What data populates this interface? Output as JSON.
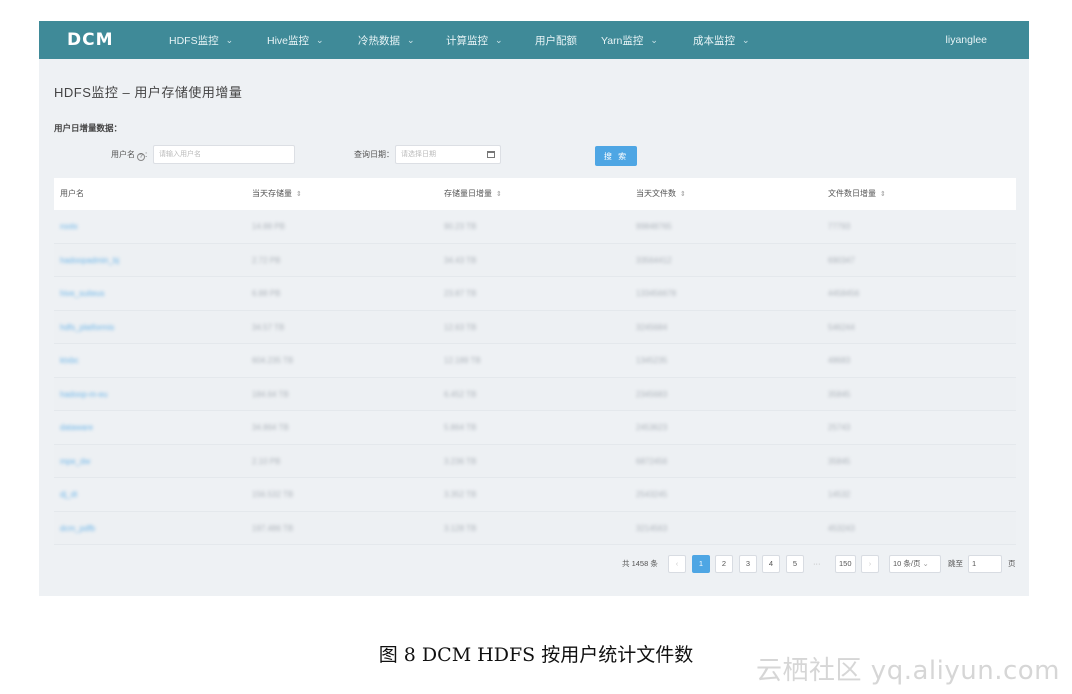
{
  "nav": {
    "logo": "DCM",
    "items": [
      {
        "label": "HDFS监控",
        "chevron": "⌄"
      },
      {
        "label": "Hive监控",
        "chevron": "⌄"
      },
      {
        "label": "冷热数据",
        "chevron": "⌄"
      },
      {
        "label": "计算监控",
        "chevron": "⌄"
      },
      {
        "label": "用户配额",
        "chevron": ""
      },
      {
        "label": "Yarn监控",
        "chevron": "⌄"
      },
      {
        "label": "成本监控",
        "chevron": "⌄"
      }
    ],
    "user": "liyanglee"
  },
  "page": {
    "title": "HDFS监控 – 用户存储使用增量",
    "section_label": "用户日增量数据："
  },
  "filters": {
    "username_label": "用户名",
    "username_placeholder": "请输入用户名",
    "date_label": "查询日期：",
    "date_placeholder": "请选择日期",
    "search_button": "搜 索"
  },
  "table": {
    "columns": [
      {
        "label": "用户名",
        "sortable": false
      },
      {
        "label": "当天存储量",
        "sortable": true
      },
      {
        "label": "存储量日增量",
        "sortable": true
      },
      {
        "label": "当天文件数",
        "sortable": true
      },
      {
        "label": "文件数日增量",
        "sortable": true
      }
    ],
    "sort_glyph": "⇕",
    "rows": [
      [
        "rootx",
        "14.88 PB",
        "90.23 TB",
        "99848765",
        "77793"
      ],
      [
        "hadoopadmin_bj",
        "2.72 PB",
        "34.43 TB",
        "33564412",
        "690347"
      ],
      [
        "hive_suiteus",
        "6.88 PB",
        "23.87 TB",
        "133456678",
        "4458456"
      ],
      [
        "hdfs_platformis",
        "34.57 TB",
        "12.63 TB",
        "3245684",
        "546244"
      ],
      [
        "ktxbc",
        "604.235 TB",
        "12.189 TB",
        "1345235",
        "48683"
      ],
      [
        "hadoop-m-eu",
        "184.64 TB",
        "6.452 TB",
        "2345683",
        "35845"
      ],
      [
        "dataware",
        "34.864 TB",
        "5.864 TB",
        "2453623",
        "25743"
      ],
      [
        "mpe_dw",
        "2.10 PB",
        "3.236 TB",
        "6872456",
        "35845"
      ],
      [
        "dj_dt",
        "156.532 TB",
        "3.352 TB",
        "2543245",
        "14532"
      ],
      [
        "dcm_pdfb",
        "197.486 TB",
        "3.128 TB",
        "3214563",
        "453243"
      ]
    ]
  },
  "pagination": {
    "total": "共 1458 条",
    "prev": "‹",
    "pages": [
      "1",
      "2",
      "3",
      "4",
      "5"
    ],
    "active_page": "1",
    "ellipsis": "···",
    "last_page": "150",
    "next": "›",
    "page_size": "10 条/页",
    "goto_label": "跳至",
    "goto_value": "1",
    "goto_suffix": "页"
  },
  "caption": "图 8 DCM HDFS 按用户统计文件数",
  "watermark": "云栖社区 yq.aliyun.com"
}
